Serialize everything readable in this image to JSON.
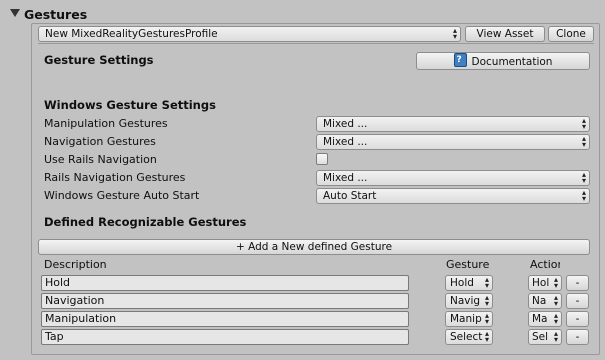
{
  "header": {
    "title": "Gestures",
    "profile_value": "New MixedRealityGesturesProfile",
    "view_asset_label": "View Asset",
    "clone_label": "Clone"
  },
  "gesture_settings": {
    "title": "Gesture Settings",
    "documentation_label": "Documentation"
  },
  "windows": {
    "title": "Windows Gesture Settings",
    "rows": [
      {
        "label": "Manipulation Gestures",
        "value": "Mixed ..."
      },
      {
        "label": "Navigation Gestures",
        "value": "Mixed ..."
      },
      {
        "label": "Use Rails Navigation",
        "checked": false
      },
      {
        "label": "Rails Navigation Gestures",
        "value": "Mixed ..."
      },
      {
        "label": "Windows Gesture Auto Start",
        "value": "Auto Start"
      }
    ]
  },
  "defined": {
    "title": "Defined Recognizable Gestures",
    "add_label": "+ Add a New defined Gesture",
    "col_description": "Description",
    "col_gesture": "Gesture",
    "col_action": "Actior",
    "remove_label": "-",
    "rows": [
      {
        "description": "Hold",
        "gesture": "Hold",
        "action": "Hol"
      },
      {
        "description": "Navigation",
        "gesture": "Navig",
        "action": "Na"
      },
      {
        "description": "Manipulation",
        "gesture": "Manip",
        "action": "Ma"
      },
      {
        "description": "Tap",
        "gesture": "Select",
        "action": "Sel"
      }
    ]
  }
}
